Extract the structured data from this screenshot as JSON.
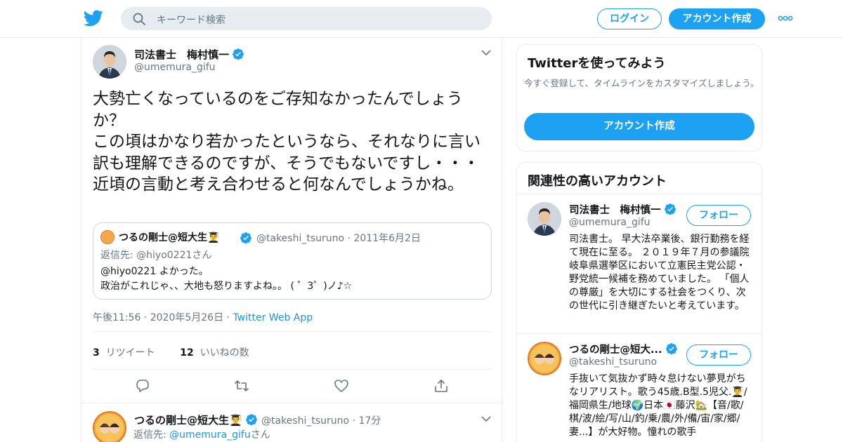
{
  "search": {
    "placeholder": "キーワード検索"
  },
  "header": {
    "login_label": "ログイン",
    "signup_label": "アカウント作成"
  },
  "tweet": {
    "author_name": "司法書士　梅村慎一",
    "author_handle": "@umemura_gifu",
    "text": "大勢亡くなっているのをご存知なかったんでしょうか？\nこの頃はかなり若かったというなら、それなりに言い訳も理解できるのですが、そうでもないですし・・・近頃の言動と考え合わせると何なんでしょうかね。",
    "quote": {
      "author_name": "つるの剛士@短大生👨‍🎓",
      "author_handle": "@takeshi_tsuruno",
      "date": "2011年6月2日",
      "reply_to_label": "返信先: @hiyo0221さん",
      "body_line1": "@hiyo0221 よかった。",
      "body_line2": "政治がこれじゃ、、大地も怒りますよね。。 ( ゜3゜)ノ♪☆"
    },
    "time": "午後11:56",
    "date": "2020年5月26日",
    "source": "Twitter Web App",
    "retweet_count": "3",
    "retweet_label": "リツイート",
    "like_count": "12",
    "like_label": "いいねの数"
  },
  "reply": {
    "author_name": "つるの剛士@短大生👨‍🎓",
    "author_handle": "@takeshi_tsuruno",
    "time": "17分",
    "reply_prefix": "返信先: ",
    "reply_handle": "@umemura_gifu",
    "reply_suffix": "さん"
  },
  "sidebar": {
    "try_title": "Twitterを使ってみよう",
    "try_sub": "今すぐ登録して、タイムラインをカスタマイズしましょう。",
    "try_button": "アカウント作成",
    "related_title": "関連性の高いアカウント",
    "follow_label": "フォロー",
    "accounts": [
      {
        "name": "司法書士　梅村慎一",
        "handle": "@umemura_gifu",
        "bio": "司法書士。 早大法卒業後、銀行勤務を経て現在に至る。 ２０１９年７月の参議院岐阜県選挙区において立憲民主党公認・野党統一候補を務めていました。 「個人の尊厳」を大切にする社会をつくり、次の世代に引き継ぎたいと考えています。"
      },
      {
        "name": "つるの剛士@短大...",
        "handle": "@takeshi_tsuruno",
        "bio": "手抜いて気抜かず時々怠けない夢見がちなリアリスト。歌う45歳.B型.5児父.👨‍🎓/福岡県生/地球🌍日本🇯🇵藤沢🏡【音/歌/棋/波/絵/写/山/釣/乗/農/外/備/宙/家/郷/妻...】が大好物。憧れの歌手"
      }
    ]
  },
  "colors": {
    "accent": "#1da1f2",
    "link": "#1b95e0",
    "muted": "#657786",
    "border": "#e6ecf0"
  }
}
